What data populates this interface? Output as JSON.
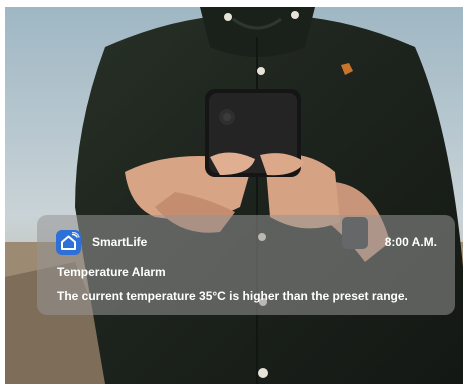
{
  "notification": {
    "app_name": "SmartLife",
    "app_icon": "smartlife-home-icon",
    "time": "8:00 A.M.",
    "title": "Temperature Alarm",
    "message": "The current temperature 35°C is higher than the preset range."
  },
  "colors": {
    "app_icon_blue": "#2f6fd8",
    "notification_background": "#969696",
    "text": "#ffffff"
  }
}
